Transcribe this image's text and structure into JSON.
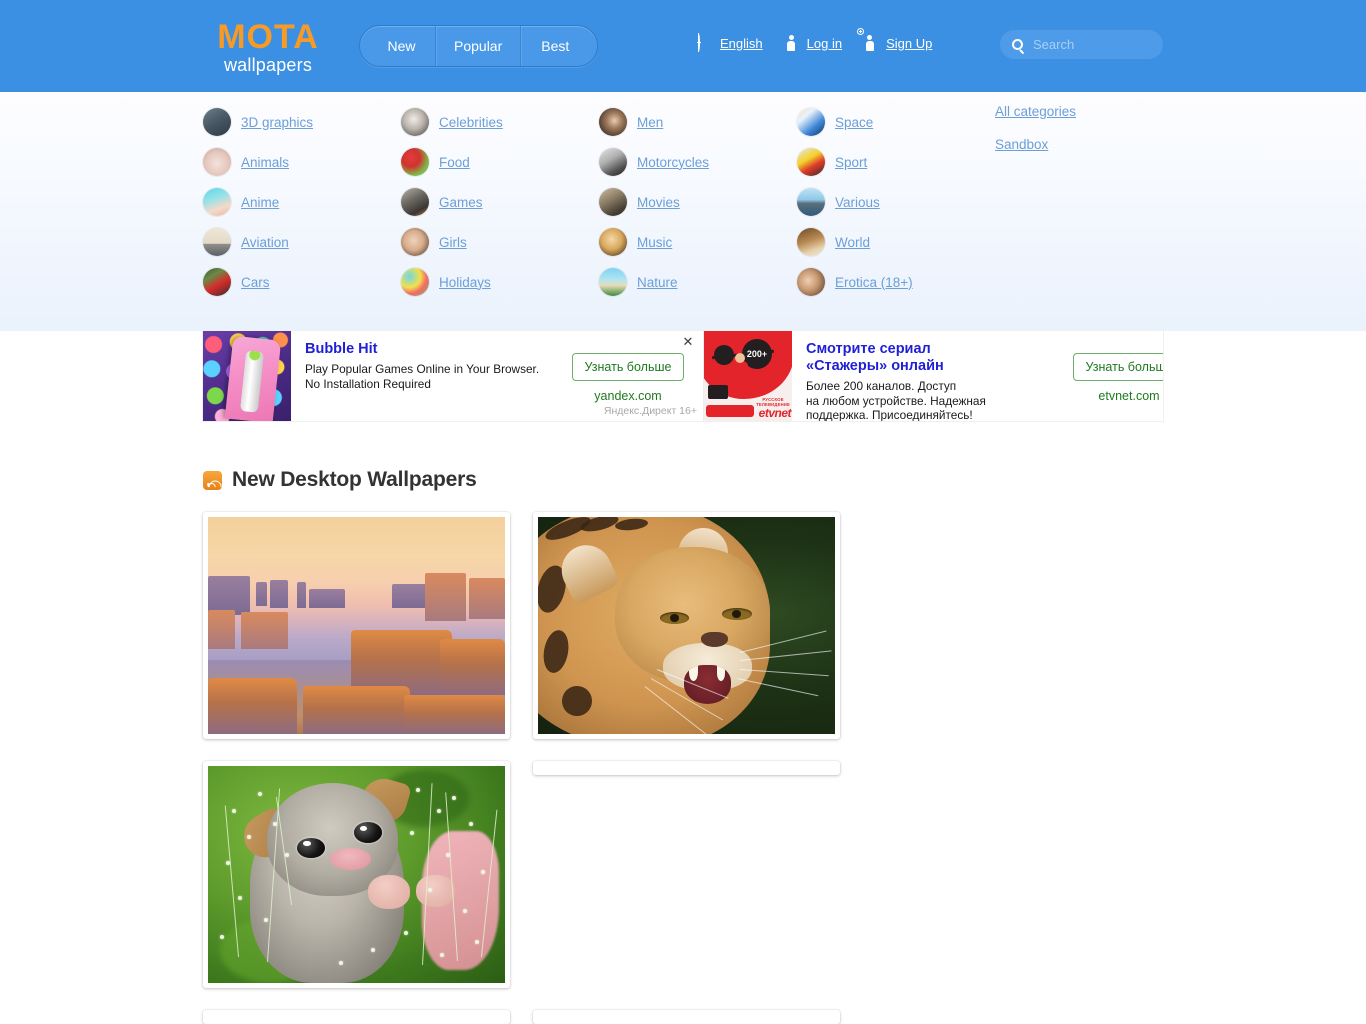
{
  "brand": {
    "logo_main": "MOTA",
    "logo_sub": "wallpapers",
    "accent_color": "#f79a26",
    "header_color": "#3c90e3"
  },
  "nav": {
    "pills": [
      {
        "label": "New",
        "active": true
      },
      {
        "label": "Popular",
        "active": false
      },
      {
        "label": "Best",
        "active": false
      }
    ]
  },
  "header_links": [
    {
      "label": "English",
      "icon": "globe-icon"
    },
    {
      "label": "Log in",
      "icon": "person-icon"
    },
    {
      "label": "Sign Up",
      "icon": "person-add-icon"
    }
  ],
  "search": {
    "placeholder": "Search",
    "value": "",
    "icon": "search-icon"
  },
  "categories": {
    "columns": [
      [
        {
          "label": "3D graphics"
        },
        {
          "label": "Animals"
        },
        {
          "label": "Anime"
        },
        {
          "label": "Aviation"
        },
        {
          "label": "Cars"
        }
      ],
      [
        {
          "label": "Celebrities"
        },
        {
          "label": "Food"
        },
        {
          "label": "Games"
        },
        {
          "label": "Girls"
        },
        {
          "label": "Holidays"
        }
      ],
      [
        {
          "label": "Men"
        },
        {
          "label": "Motorcycles"
        },
        {
          "label": "Movies"
        },
        {
          "label": "Music"
        },
        {
          "label": "Nature"
        }
      ],
      [
        {
          "label": "Space"
        },
        {
          "label": "Sport"
        },
        {
          "label": "Various"
        },
        {
          "label": "World"
        },
        {
          "label": "Erotica (18+)"
        }
      ]
    ],
    "extra_links": [
      {
        "label": "All categories"
      },
      {
        "label": "Sandbox"
      }
    ]
  },
  "ads": [
    {
      "title": "Bubble Hit",
      "description": "Play Popular Games Online in Your Browser.\nNo Installation Required",
      "cta": "Узнать больше",
      "domain": "yandex.com",
      "meta": "Яндекс.Директ  16+",
      "close": "✕"
    },
    {
      "title": "Смотрите сериал «Стажеры» онлайн",
      "description": "Более 200 каналов. Доступ\nна любом устройстве. Надежная\nподдержка. Присоединяйтесь!",
      "cta": "Узнать больше",
      "domain": "etvnet.com",
      "meta": "",
      "badge": "200+",
      "brand_caption": "РУССКОЕ\nТЕЛЕВИДЕНИЕ",
      "brand_logo": "etvnet"
    }
  ],
  "section": {
    "title": "New Desktop Wallpapers",
    "rss_icon": "rss-icon"
  },
  "wallpapers": [
    {
      "name": "monument-valley-sunset"
    },
    {
      "name": "snarling-serval-cat"
    },
    {
      "name": "brushtail-possum-in-flowers"
    }
  ]
}
